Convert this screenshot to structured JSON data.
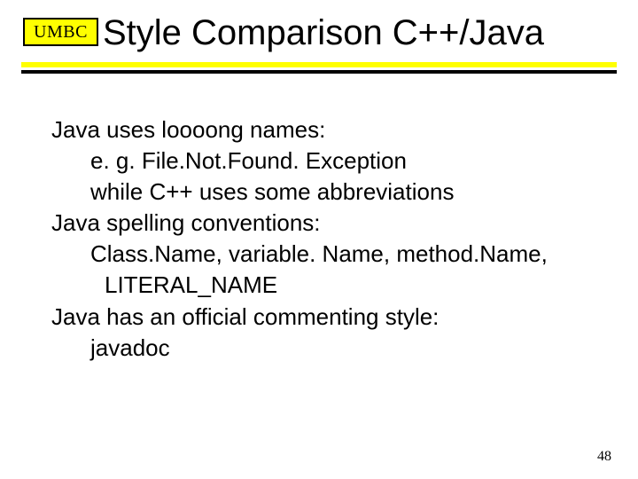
{
  "header": {
    "badge": "UMBC",
    "title": "Style Comparison C++/Java"
  },
  "body": {
    "line1": "Java uses loooong names:",
    "line2": "e. g. File.Not.Found. Exception",
    "line3": "while C++ uses some abbreviations",
    "line4": "Java spelling conventions:",
    "line5": "Class.Name,  variable. Name,  method.Name,",
    "line6": "LITERAL_NAME",
    "line7": "Java has an official commenting style:",
    "line8": "javadoc"
  },
  "footer": {
    "page_number": "48"
  }
}
